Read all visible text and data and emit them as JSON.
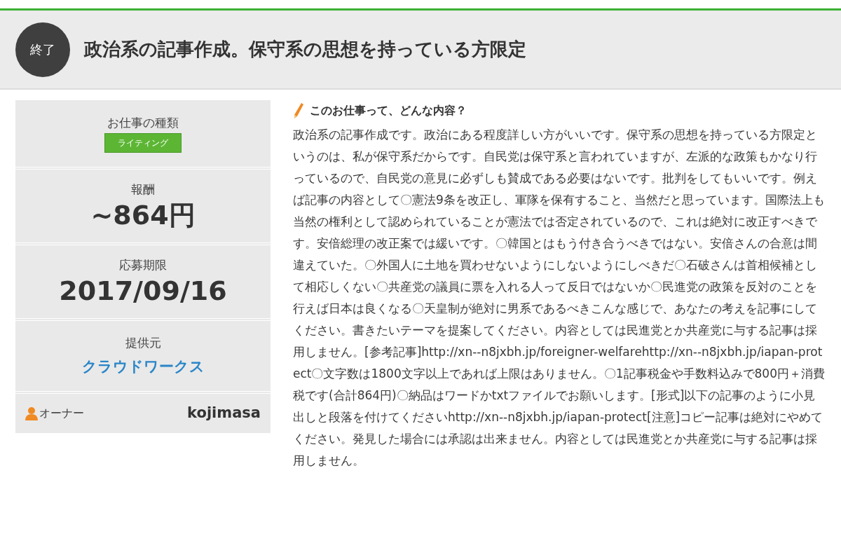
{
  "header": {
    "status": "終了",
    "title": "政治系の記事作成。保守系の思想を持っている方限定"
  },
  "sidebar": [
    {
      "kind": "tag",
      "label": "お仕事の種類",
      "value": "ライティング"
    },
    {
      "kind": "big",
      "label": "報酬",
      "value": "~864円"
    },
    {
      "kind": "big",
      "label": "応募期限",
      "value": "2017/09/16"
    },
    {
      "kind": "link",
      "label": "提供元",
      "value": "クラウドワークス"
    },
    {
      "kind": "owner",
      "label": "オーナー",
      "value": "kojimasa"
    }
  ],
  "content": {
    "heading": "このお仕事って、どんな内容？",
    "body": "政治系の記事作成です。政治にある程度詳しい方がいいです。保守系の思想を持っている方限定というのは、私が保守系だからです。自民党は保守系と言われていますが、左派的な政策もかなり行っているので、自民党の意見に必ずしも賛成である必要はないです。批判をしてもいいです。例えば記事の内容として〇憲法9条を改正し、軍隊を保有すること、当然だと思っています。国際法上も当然の権利として認められていることが憲法では否定されているので、これは絶対に改正すべきです。安倍総理の改正案では緩いです。〇韓国とはもう付き合うべきではない。安倍さんの合意は間違えていた。〇外国人に土地を買わせないようにしないようにしべきだ〇石破さんは首相候補として相応しくない〇共産党の議員に票を入れる人って反日ではないか〇民進党の政策を反対のことを行えば日本は良くなる〇天皇制が絶対に男系であるべきこんな感じで、あなたの考えを記事にしてください。書きたいテーマを提案してください。内容としては民進党とか共産党に与する記事は採用しません。[参考記事]http://xn--n8jxbh.jp/foreigner-welfarehttp://xn--n8jxbh.jp/iapan-protect〇文字数は1800文字以上であれば上限はありません。〇1記事税金や手数料込みで800円＋消費税です(合計864円)〇納品はワードかtxtファイルでお願いします。[形式]以下の記事のように小見出しと段落を付けてくださいhttp://xn--n8jxbh.jp/iapan-protect[注意]コピー記事は絶対にやめてください。発見した場合には承認は出来ません。内容としては民進党とか共産党に与する記事は採用しません。"
  }
}
